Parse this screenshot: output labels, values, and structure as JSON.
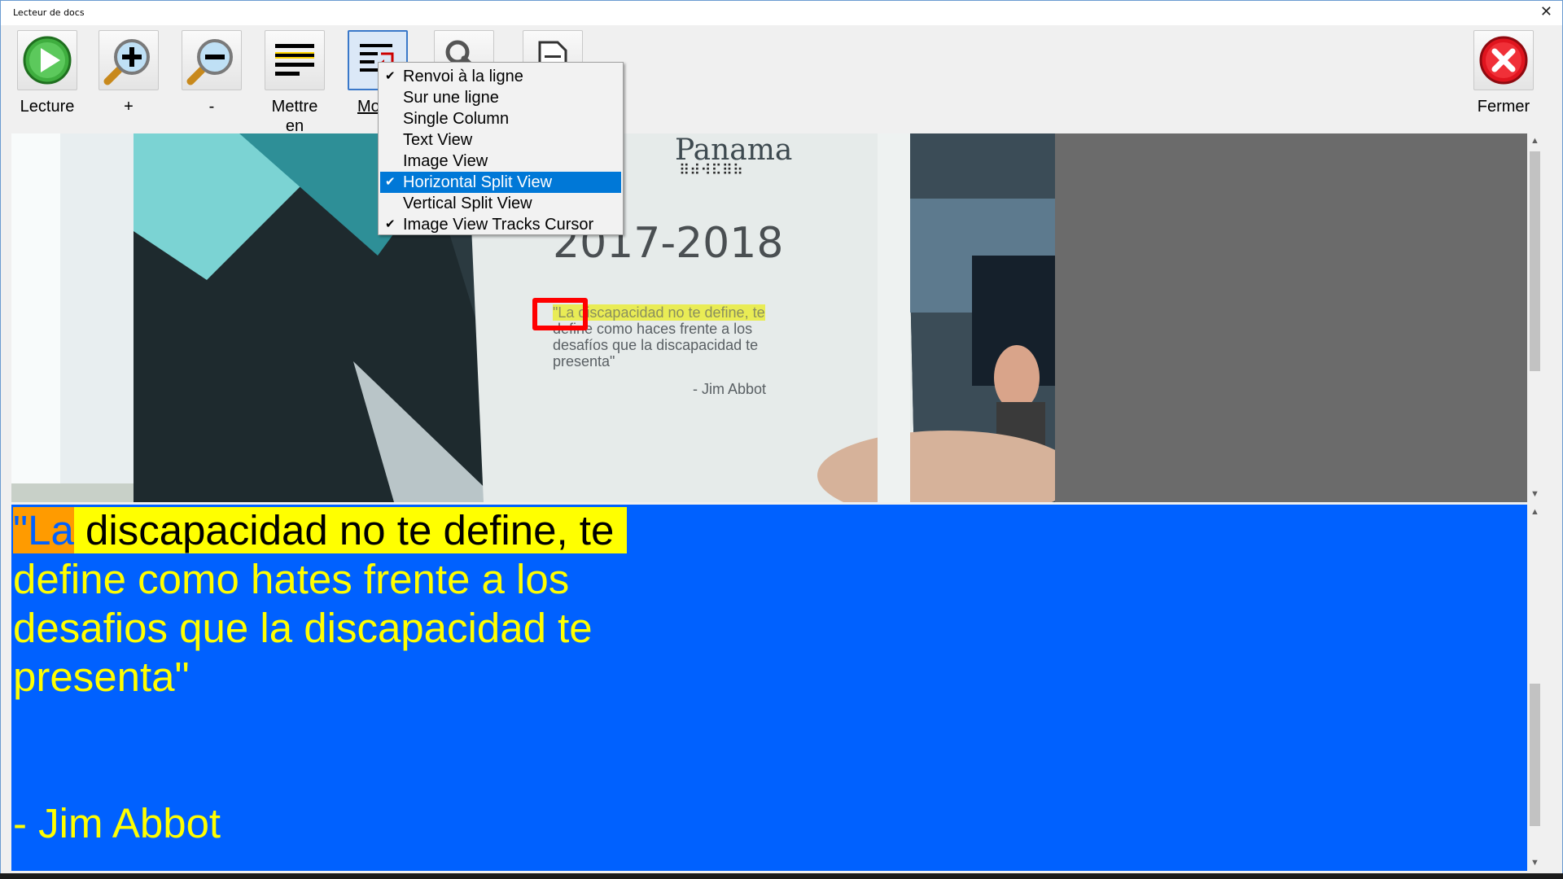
{
  "window": {
    "title": "Lecteur de docs",
    "close_glyph": "✕"
  },
  "toolbar": {
    "buttons": [
      {
        "id": "play",
        "label": "Lecture",
        "icon": "play-icon"
      },
      {
        "id": "zoom-in",
        "label": "+",
        "icon": "zoom-in-icon"
      },
      {
        "id": "zoom-out",
        "label": "-",
        "icon": "zoom-out-icon"
      },
      {
        "id": "highlight",
        "label": "Mettre en",
        "icon": "lines-highlight-icon"
      },
      {
        "id": "mode",
        "label": "Mo",
        "icon": "wrap-lines-icon"
      },
      {
        "id": "settings",
        "label": "",
        "icon": "wrench-icon"
      },
      {
        "id": "document",
        "label": "",
        "icon": "document-icon"
      },
      {
        "id": "close",
        "label": "Fermer",
        "icon": "close-circle-icon"
      }
    ]
  },
  "view_menu": {
    "items": [
      {
        "label": "Renvoi à la ligne",
        "checked": true,
        "selected": false
      },
      {
        "label": "Sur une ligne",
        "checked": false,
        "selected": false
      },
      {
        "label": "Single Column",
        "checked": false,
        "selected": false
      },
      {
        "label": "Text View",
        "checked": false,
        "selected": false
      },
      {
        "label": "Image View",
        "checked": false,
        "selected": false
      },
      {
        "label": "Horizontal Split View",
        "checked": true,
        "selected": true
      },
      {
        "label": "Vertical Split View",
        "checked": false,
        "selected": false
      },
      {
        "label": "Image View Tracks Cursor",
        "checked": true,
        "selected": false
      }
    ],
    "check_glyph": "✔"
  },
  "photo": {
    "brand": "Panama",
    "year": "2017-2018",
    "ocr_lines": [
      "\"La discapacidad no te define, te",
      "define como haces frente a los",
      "desafíos que la discapacidad te",
      "presenta\""
    ],
    "attribution": "- Jim Abbot"
  },
  "text_view": {
    "line1": {
      "word": "\"La",
      "rest_highlighted": " discapacidad no te define, te"
    },
    "lines": [
      "define como hates frente a los",
      "desafios que la discapacidad te",
      "presenta\"",
      "",
      "",
      "- Jim Abbot"
    ],
    "background": "#0061ff",
    "text_color": "#ffff00",
    "word_highlight": "#ff9b00",
    "sentence_highlight": "#ffff00"
  },
  "scrollbars": {
    "up_glyph": "▲",
    "down_glyph": "▼"
  }
}
